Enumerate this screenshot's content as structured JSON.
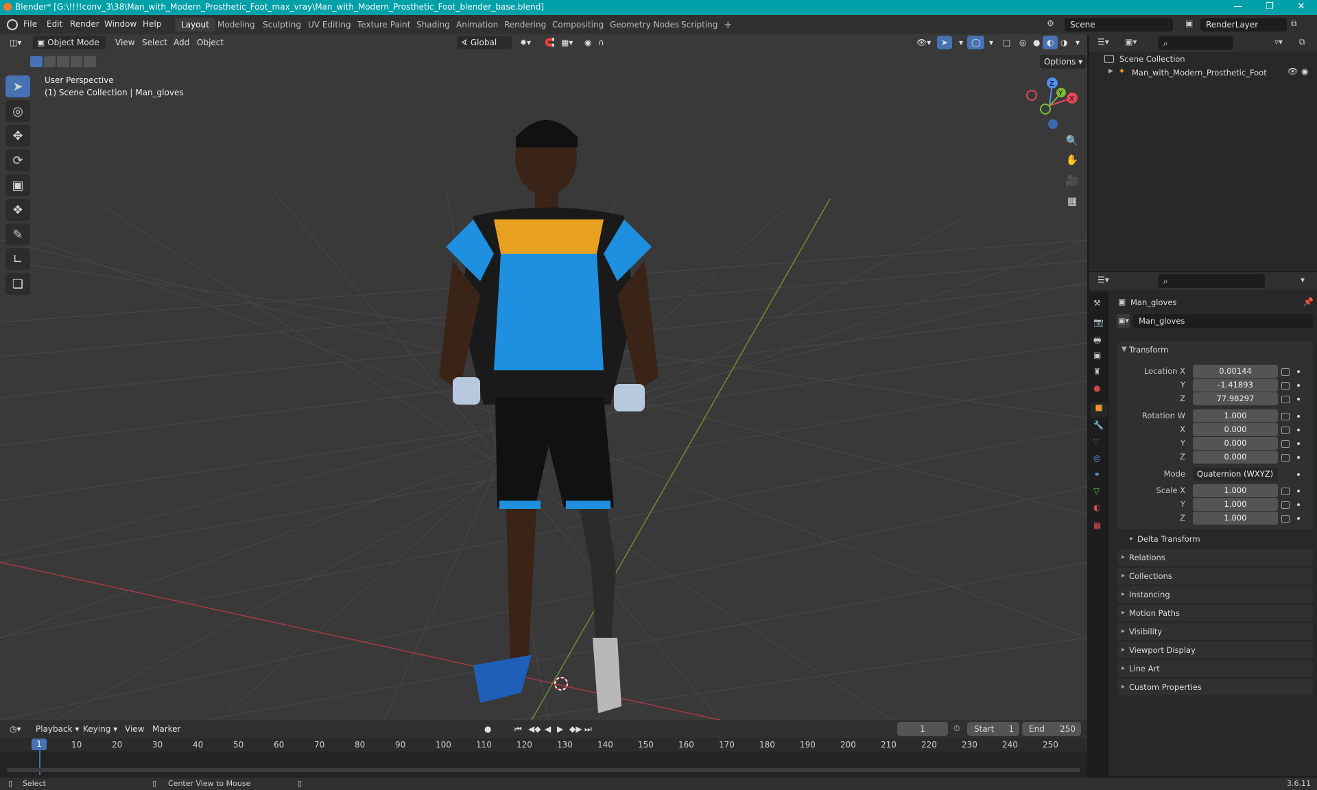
{
  "title": "Blender* [G:\\!!!!conv_3\\38\\Man_with_Modern_Prosthetic_Foot_max_vray\\Man_with_Modern_Prosthetic_Foot_blender_base.blend]",
  "menus": [
    "File",
    "Edit",
    "Render",
    "Window",
    "Help"
  ],
  "workspaces": [
    "Layout",
    "Modeling",
    "Sculpting",
    "UV Editing",
    "Texture Paint",
    "Shading",
    "Animation",
    "Rendering",
    "Compositing",
    "Geometry Nodes",
    "Scripting"
  ],
  "active_workspace": "Layout",
  "scene_name": "Scene",
  "render_layer": "RenderLayer",
  "viewport": {
    "mode": "Object Mode",
    "header_menus": [
      "View",
      "Select",
      "Add",
      "Object"
    ],
    "orientation": "Global",
    "options_label": "Options",
    "overlay_line1": "User Perspective",
    "overlay_line2": "(1) Scene Collection | Man_gloves",
    "gizmo_axes": [
      "Z",
      "Y",
      "X"
    ]
  },
  "outliner": {
    "root": "Scene Collection",
    "items": [
      "Man_with_Modern_Prosthetic_Foot"
    ]
  },
  "properties": {
    "object_name": "Man_gloves",
    "data_name": "Man_gloves",
    "transform_label": "Transform",
    "location": {
      "label": "Location X",
      "x": "0.00144",
      "y": "-1.41893",
      "z": "77.98297"
    },
    "rotation": {
      "label": "Rotation W",
      "w": "1.000",
      "x": "0.000",
      "y": "0.000",
      "z": "0.000"
    },
    "mode_label": "Mode",
    "mode_value": "Quaternion (WXYZ)",
    "scale": {
      "label": "Scale X",
      "x": "1.000",
      "y": "1.000",
      "z": "1.000"
    },
    "axis_labels": {
      "x": "X",
      "y": "Y",
      "z": "Z"
    },
    "delta_transform": "Delta Transform",
    "panels": [
      "Relations",
      "Collections",
      "Instancing",
      "Motion Paths",
      "Visibility",
      "Viewport Display",
      "Line Art",
      "Custom Properties"
    ]
  },
  "timeline": {
    "menus": [
      "Playback",
      "Keying",
      "View",
      "Marker"
    ],
    "current_frame": "1",
    "start_label": "Start",
    "start": "1",
    "end_label": "End",
    "end": "250",
    "ticks": [
      "1",
      "10",
      "20",
      "30",
      "40",
      "50",
      "60",
      "70",
      "80",
      "90",
      "100",
      "110",
      "120",
      "130",
      "140",
      "150",
      "160",
      "170",
      "180",
      "190",
      "200",
      "210",
      "220",
      "230",
      "240",
      "250"
    ]
  },
  "status": {
    "left": "Select",
    "middle": "Center View to Mouse",
    "version": "3.6.11"
  }
}
